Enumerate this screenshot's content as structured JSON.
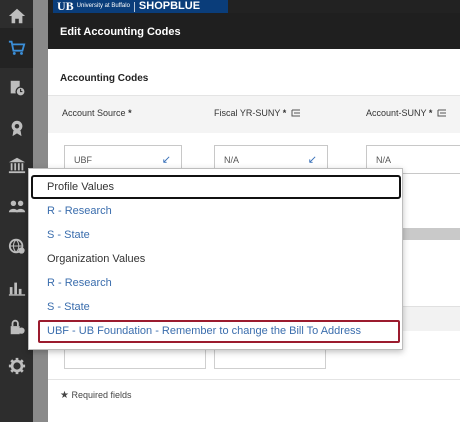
{
  "banner": {
    "logo_letters": "UB",
    "university": "University at Buffalo",
    "product": "SHOPBLUE"
  },
  "nav": {
    "items": [
      {
        "icon": "home-icon"
      },
      {
        "icon": "cart-icon"
      },
      {
        "icon": "document-clock-icon"
      },
      {
        "icon": "award-icon"
      },
      {
        "icon": "bank-icon"
      },
      {
        "icon": "users-icon"
      },
      {
        "icon": "globe-gear-icon"
      },
      {
        "icon": "bar-chart-icon"
      },
      {
        "icon": "lock-gear-icon"
      },
      {
        "icon": "gear-icon"
      }
    ]
  },
  "modal": {
    "title": "Edit Accounting Codes",
    "section_title": "Accounting Codes",
    "fields": [
      {
        "label": "Account Source",
        "required": "*",
        "value": "UBF"
      },
      {
        "label": "Fiscal YR-SUNY",
        "required": "*",
        "value": "N/A"
      },
      {
        "label": "Account-SUNY",
        "required": "*",
        "value": "N/A"
      }
    ],
    "required_note": "Required fields",
    "required_star": "★"
  },
  "dropdown": {
    "groups": [
      {
        "label": "Profile Values",
        "options": [
          "R - Research",
          "S - State"
        ]
      },
      {
        "label": "Organization Values",
        "options": [
          "R - Research",
          "S - State",
          "UBF - UB Foundation - Remember to change the Bill To Address"
        ]
      }
    ]
  },
  "colors": {
    "link_blue": "#3a6dad",
    "highlight_red": "#9b1b2e",
    "nav_bg": "#2d2d2d",
    "brand_blue": "#0a3d7a"
  }
}
